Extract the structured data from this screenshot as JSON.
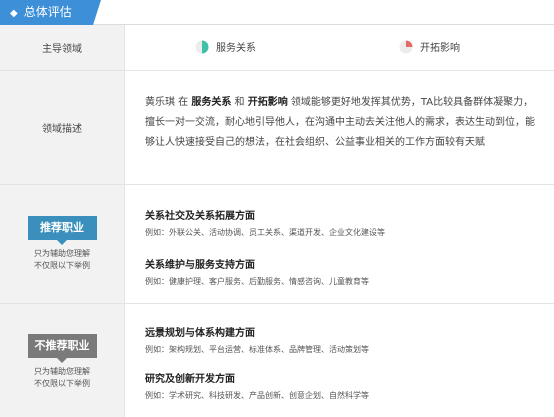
{
  "section": {
    "title": "总体评估"
  },
  "rows": {
    "domain": {
      "label": "主导领域",
      "items": [
        {
          "name": "服务关系",
          "icon": "quarter-circle-green-icon",
          "color": "#3fc1a8"
        },
        {
          "name": "开拓影响",
          "icon": "quarter-circle-red-icon",
          "color": "#e46a6a"
        }
      ]
    },
    "description": {
      "label": "领域描述",
      "prefix": "黄乐琪 在 ",
      "domain1": "服务关系",
      "and": " 和 ",
      "domain2": "开拓影响",
      "body": " 领域能够更好地发挥其优势，TA比较具备群体凝聚力，擅长一对一交流，耐心地引导他人，在沟通中主动去关注他人的需求，表达生动到位，能够让人快速接受自己的想法，在社会组织、公益事业相关的工作方面较有天赋"
    },
    "recommended": {
      "tag": "推荐职业",
      "note_line1": "只为辅助您理解",
      "note_line2": "不仅限以下举例",
      "categories": [
        {
          "title": "关系社交及关系拓展方面",
          "example": "例如：外联公关、活动协调、员工关系、渠道开发、企业文化建设等"
        },
        {
          "title": "关系维护与服务支持方面",
          "example": "例如：健康护理、客户服务、后勤服务、情感咨询、儿童教育等"
        }
      ]
    },
    "not_recommended": {
      "tag": "不推荐职业",
      "note_line1": "只为辅助您理解",
      "note_line2": "不仅限以下举例",
      "categories": [
        {
          "title": "远景规划与体系构建方面",
          "example": "例如：架构规划、平台运营、标准体系、品牌管理、活动策划等"
        },
        {
          "title": "研究及创新开发方面",
          "example": "例如：学术研究、科技研发、产品创新、创意企划、自然科学等"
        }
      ]
    }
  }
}
